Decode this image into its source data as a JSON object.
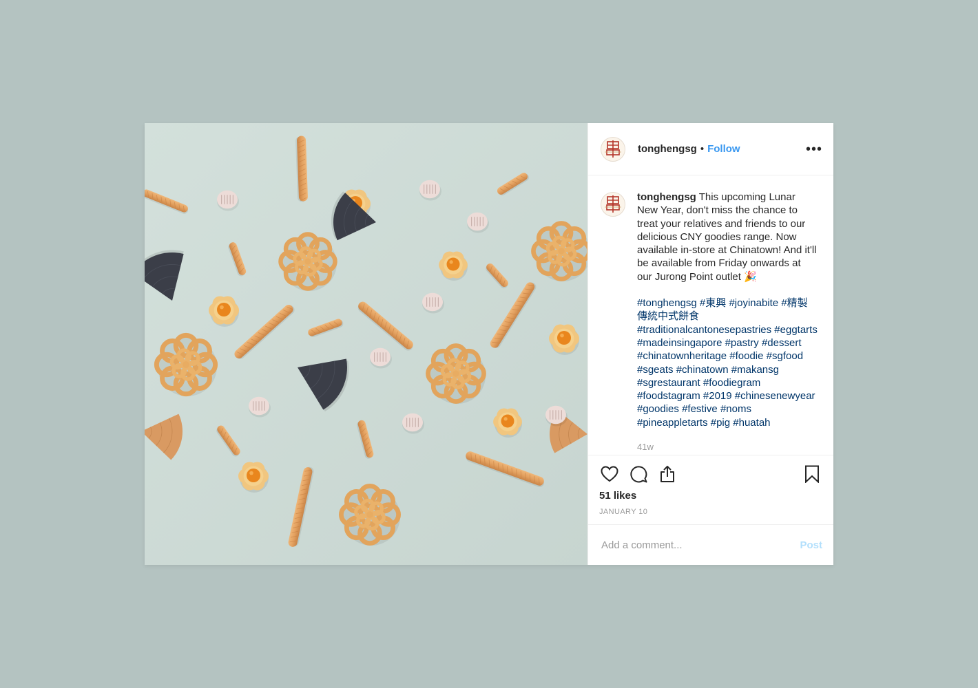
{
  "post": {
    "username": "tonghengsg",
    "separator": "•",
    "follow_label": "Follow",
    "more_label": "•••",
    "caption_text": "This upcoming Lunar New Year, don't miss the chance to treat your relatives and friends to our delicious CNY goodies range. Now available in-store at Chinatown! And it'll be available from Friday onwards at our Jurong Point outlet 🎉",
    "hashtags": [
      "#tonghengsg",
      "#東興",
      "#joyinabite",
      "#精製傳統中式餅食",
      "#traditionalcantonesepastries",
      "#eggtarts",
      "#madeinsingapore",
      "#pastry",
      "#dessert",
      "#chinatownheritage",
      "#foodie",
      "#sgfood",
      "#sgeats",
      "#chinatown",
      "#makansg",
      "#sgrestaurant",
      "#foodiegram",
      "#foodstagram",
      "#2019",
      "#chinesenewyear",
      "#goodies",
      "#festive",
      "#noms",
      "#pineappletarts",
      "#pig",
      "#huatah"
    ],
    "age": "41w",
    "likes": "51 likes",
    "date": "JANUARY 10",
    "comment_placeholder": "Add a comment...",
    "post_label": "Post",
    "avatar_logo_text": "東興"
  },
  "icons": {
    "like": "heart-icon",
    "comment": "comment-icon",
    "share": "share-icon",
    "save": "bookmark-icon",
    "more": "more-options-icon"
  },
  "colors": {
    "page_background": "#b4c3c1",
    "photo_background": "#cfdcd7",
    "link_blue": "#3897f0",
    "hashtag_blue": "#003569",
    "post_disabled": "#b2dffc",
    "pastry_orange": "#e3a160",
    "tuile_dark": "#3b3e48",
    "pineapple_jam": "#e9861d",
    "fortune_pink": "#eddcd8"
  }
}
